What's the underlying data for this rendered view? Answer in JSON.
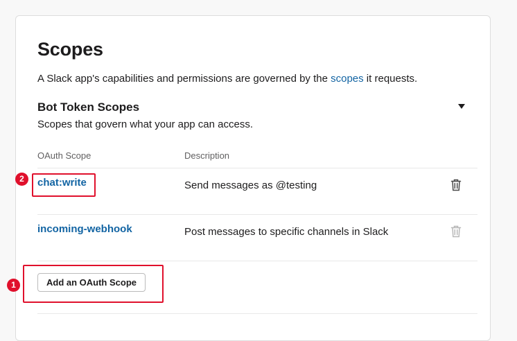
{
  "page": {
    "title": "Scopes",
    "intro_before": "A Slack app's capabilities and permissions are governed by the ",
    "intro_link": "scopes",
    "intro_after": " it requests."
  },
  "bot_token_scopes": {
    "title": "Bot Token Scopes",
    "subtitle": "Scopes that govern what your app can access.",
    "collapse_icon": "caret-down-icon",
    "columns": [
      "OAuth Scope",
      "Description"
    ],
    "rows": [
      {
        "scope": "chat:write",
        "description": "Send messages as @testing",
        "delete_enabled": true
      },
      {
        "scope": "incoming-webhook",
        "description": "Post messages to specific channels in Slack",
        "delete_enabled": false
      }
    ],
    "add_button_label": "Add an OAuth Scope"
  },
  "annotations": [
    {
      "number": "1",
      "target": "Add an OAuth Scope"
    },
    {
      "number": "2",
      "target": "chat:write"
    }
  ],
  "colors": {
    "link": "#1264a3",
    "highlight": "#e0102c",
    "text": "#1d1c1d",
    "muted": "#616061",
    "disabled_icon": "#b8b8b8"
  }
}
